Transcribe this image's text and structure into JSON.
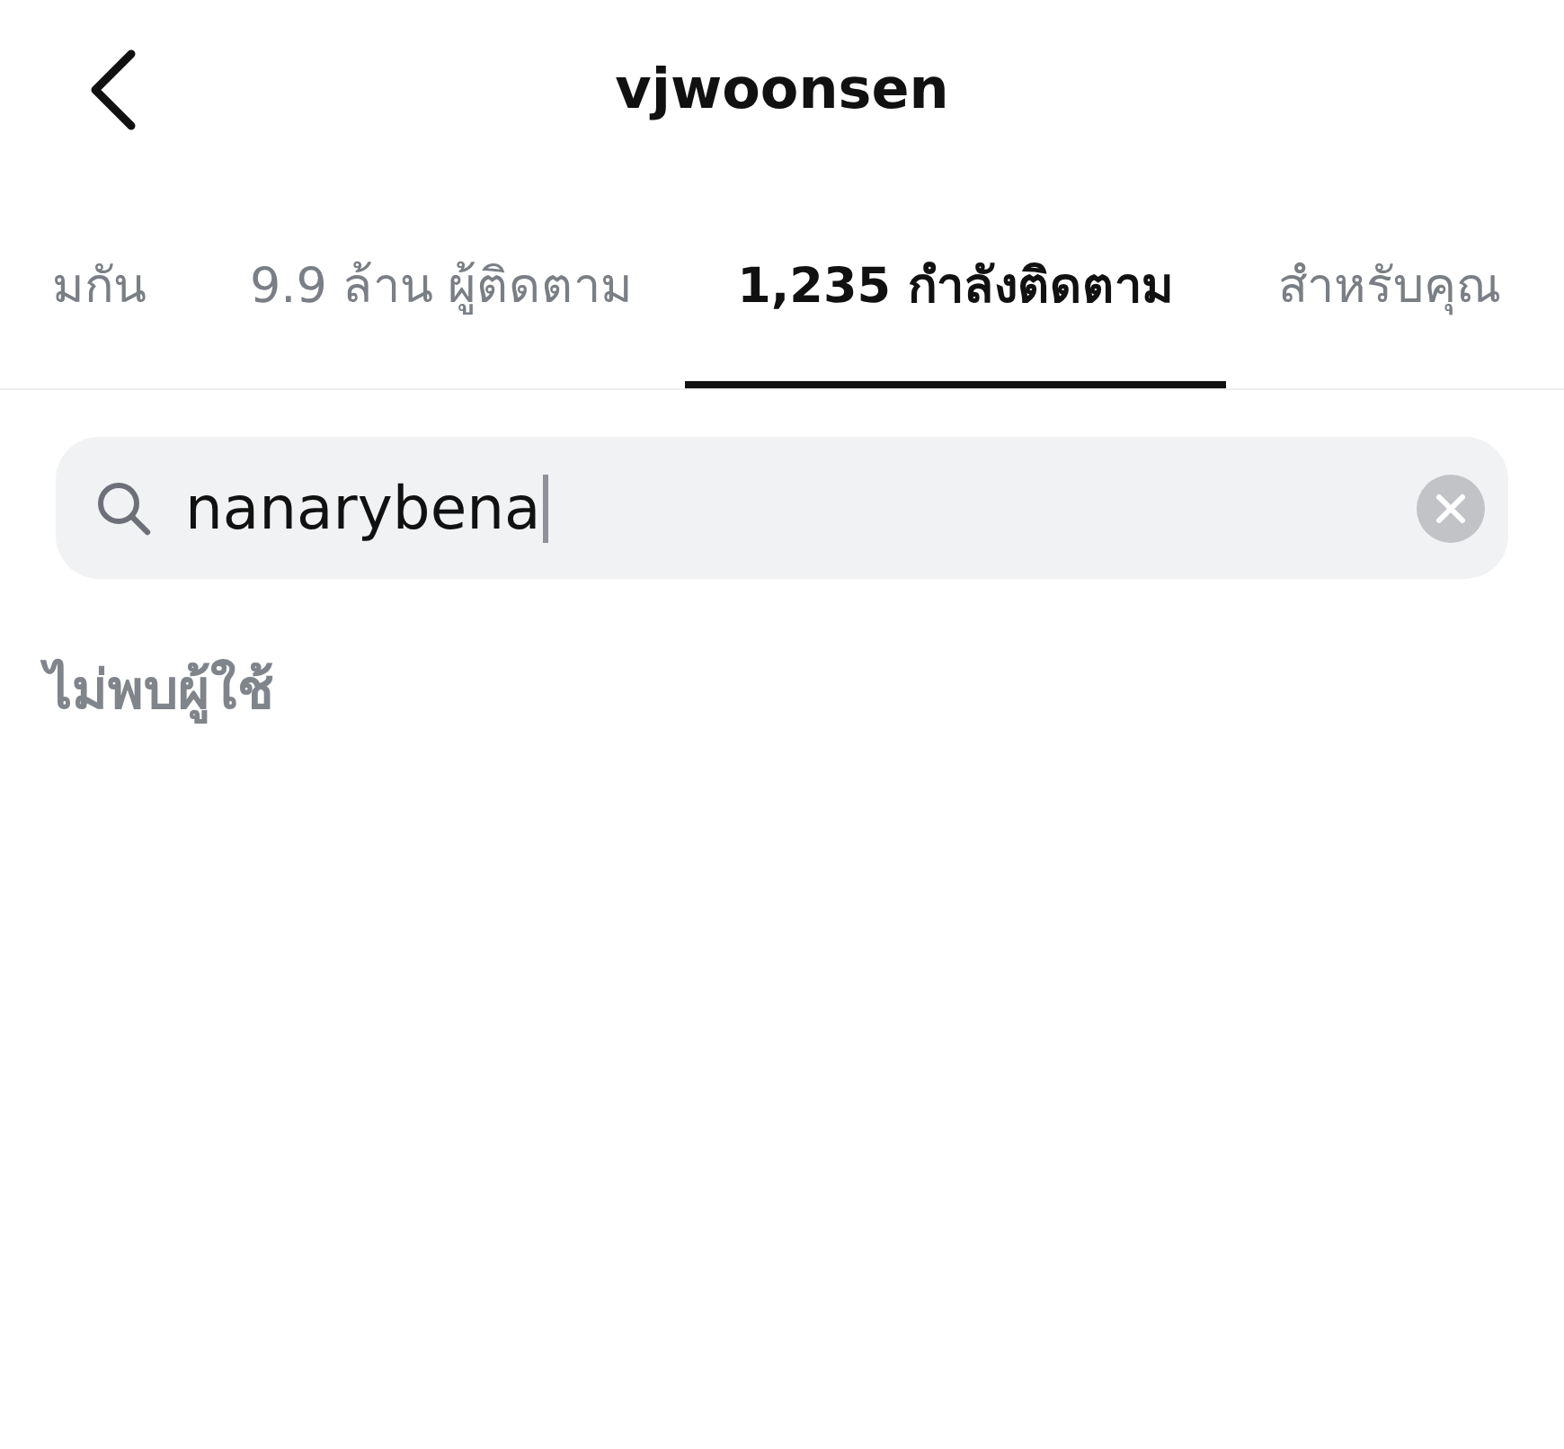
{
  "header": {
    "title": "vjwoonsen"
  },
  "tabs": [
    {
      "label": "มกัน",
      "selected": false
    },
    {
      "label": "9.9 ล้าน ผู้ติดตาม",
      "selected": false
    },
    {
      "label": "1,235 กำลังติดตาม",
      "selected": true
    },
    {
      "label": "สำหรับคุณ",
      "selected": false
    }
  ],
  "search": {
    "value": "nanarybena"
  },
  "empty_message": "ไม่พบผู้ใช้"
}
